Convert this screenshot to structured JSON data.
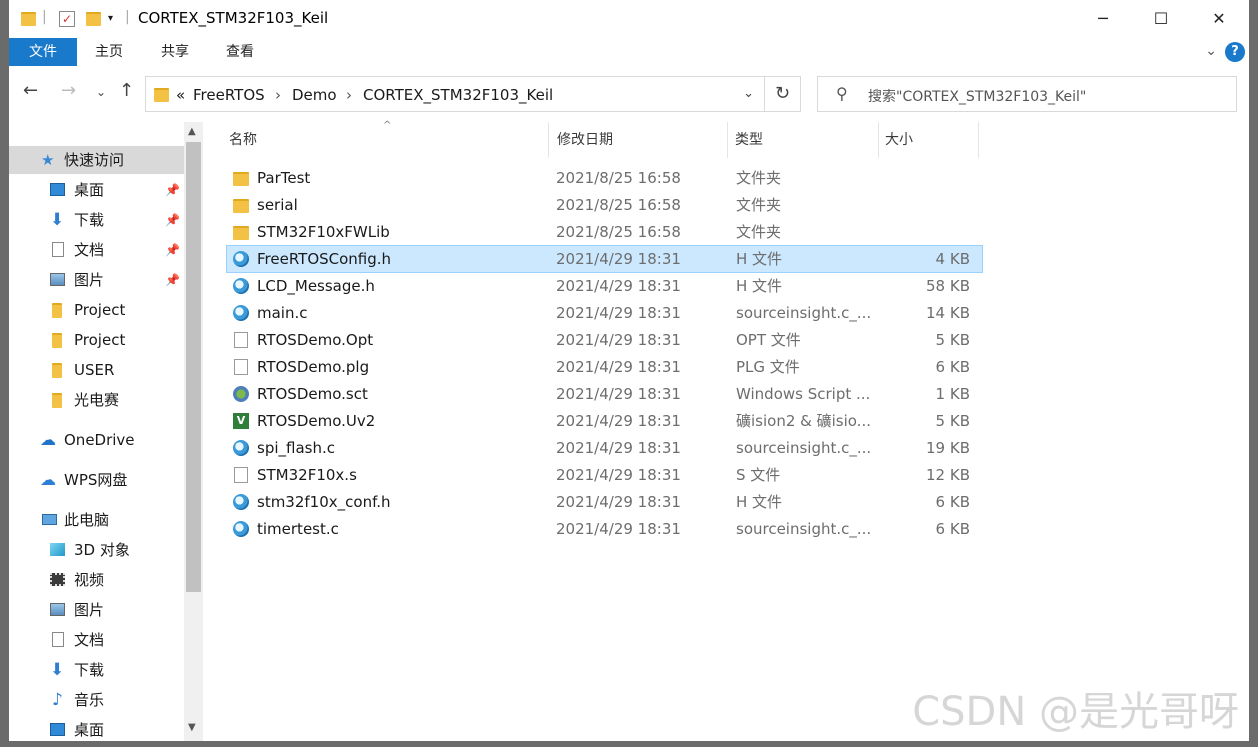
{
  "window": {
    "title": "CORTEX_STM32F103_Keil",
    "controls": {
      "minimize": "─",
      "maximize": "☐",
      "close": "✕"
    }
  },
  "ribbon": {
    "tabs": [
      {
        "label": "文件",
        "active": true
      },
      {
        "label": "主页"
      },
      {
        "label": "共享"
      },
      {
        "label": "查看"
      }
    ],
    "help": "?"
  },
  "address": {
    "overflow": "«",
    "crumbs": [
      "FreeRTOS",
      "Demo",
      "CORTEX_STM32F103_Keil"
    ],
    "separator": "›"
  },
  "search": {
    "placeholder": "搜索\"CORTEX_STM32F103_Keil\""
  },
  "navpane": {
    "items": [
      {
        "label": "快速访问",
        "icon": "star-icon",
        "pinned": false,
        "selected": true
      },
      {
        "label": "桌面",
        "icon": "desktop-icon",
        "pinned": true
      },
      {
        "label": "下载",
        "icon": "download-icon",
        "pinned": true
      },
      {
        "label": "文档",
        "icon": "document-icon",
        "pinned": true
      },
      {
        "label": "图片",
        "icon": "picture-icon",
        "pinned": true
      },
      {
        "label": "Project",
        "icon": "folder-icon"
      },
      {
        "label": "Project",
        "icon": "folder-icon"
      },
      {
        "label": "USER",
        "icon": "folder-icon"
      },
      {
        "label": "光电赛",
        "icon": "folder-icon"
      },
      {
        "label": "OneDrive",
        "icon": "cloud-icon"
      },
      {
        "label": "WPS网盘",
        "icon": "cloud-icon"
      },
      {
        "label": "此电脑",
        "icon": "computer-icon"
      },
      {
        "label": "3D 对象",
        "icon": "cube-icon"
      },
      {
        "label": "视频",
        "icon": "video-icon"
      },
      {
        "label": "图片",
        "icon": "picture-icon"
      },
      {
        "label": "文档",
        "icon": "document-icon"
      },
      {
        "label": "下载",
        "icon": "download-icon"
      },
      {
        "label": "音乐",
        "icon": "music-icon"
      },
      {
        "label": "桌面",
        "icon": "desktop-icon"
      }
    ]
  },
  "columns": {
    "name": "名称",
    "date": "修改日期",
    "type": "类型",
    "size": "大小"
  },
  "files": [
    {
      "name": "ParTest",
      "date": "2021/8/25 16:58",
      "type": "文件夹",
      "size": "",
      "icon": "folder"
    },
    {
      "name": "serial",
      "date": "2021/8/25 16:58",
      "type": "文件夹",
      "size": "",
      "icon": "folder"
    },
    {
      "name": "STM32F10xFWLib",
      "date": "2021/8/25 16:58",
      "type": "文件夹",
      "size": "",
      "icon": "folder"
    },
    {
      "name": "FreeRTOSConfig.h",
      "date": "2021/4/29 18:31",
      "type": "H 文件",
      "size": "4 KB",
      "icon": "h",
      "selected": true
    },
    {
      "name": "LCD_Message.h",
      "date": "2021/4/29 18:31",
      "type": "H 文件",
      "size": "58 KB",
      "icon": "h"
    },
    {
      "name": "main.c",
      "date": "2021/4/29 18:31",
      "type": "sourceinsight.c_...",
      "size": "14 KB",
      "icon": "h"
    },
    {
      "name": "RTOSDemo.Opt",
      "date": "2021/4/29 18:31",
      "type": "OPT 文件",
      "size": "5 KB",
      "icon": "doc"
    },
    {
      "name": "RTOSDemo.plg",
      "date": "2021/4/29 18:31",
      "type": "PLG 文件",
      "size": "6 KB",
      "icon": "doc"
    },
    {
      "name": "RTOSDemo.sct",
      "date": "2021/4/29 18:31",
      "type": "Windows Script ...",
      "size": "1 KB",
      "icon": "sct"
    },
    {
      "name": "RTOSDemo.Uv2",
      "date": "2021/4/29 18:31",
      "type": "礦ision2 & 礦isio...",
      "size": "5 KB",
      "icon": "uv2"
    },
    {
      "name": "spi_flash.c",
      "date": "2021/4/29 18:31",
      "type": "sourceinsight.c_...",
      "size": "19 KB",
      "icon": "h"
    },
    {
      "name": "STM32F10x.s",
      "date": "2021/4/29 18:31",
      "type": "S 文件",
      "size": "12 KB",
      "icon": "doc"
    },
    {
      "name": "stm32f10x_conf.h",
      "date": "2021/4/29 18:31",
      "type": "H 文件",
      "size": "6 KB",
      "icon": "h"
    },
    {
      "name": "timertest.c",
      "date": "2021/4/29 18:31",
      "type": "sourceinsight.c_...",
      "size": "6 KB",
      "icon": "h"
    }
  ],
  "watermark": "CSDN @是光哥呀"
}
